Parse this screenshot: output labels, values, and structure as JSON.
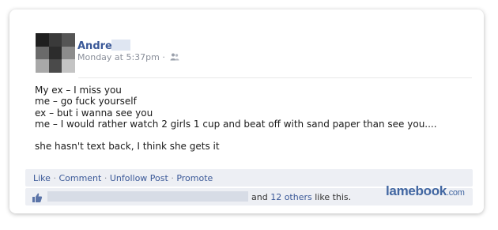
{
  "post": {
    "author_name": "Andre",
    "timestamp": "Monday at 5:37pm",
    "meta_separator": "·",
    "audience_icon": "people-icon",
    "lines": [
      "My ex – I miss you",
      "me – go fuck yourself",
      "ex – but i wanna see you",
      "me – I would rather watch 2 girls 1 cup and beat off with sand paper than see you...."
    ],
    "closing_line": "she hasn't text back, I think she gets it"
  },
  "actions": {
    "like": "Like",
    "comment": "Comment",
    "unfollow": "Unfollow Post",
    "promote": "Promote",
    "separator": "·"
  },
  "likes": {
    "icon": "thumbs-up-icon",
    "and_text": "and",
    "others_link": "12 others",
    "suffix": "like this."
  },
  "watermark": {
    "brand": "lamebook",
    "tld": ".com"
  },
  "colors": {
    "link_blue": "#3b5998",
    "action_bar_bg": "#edeff4"
  }
}
